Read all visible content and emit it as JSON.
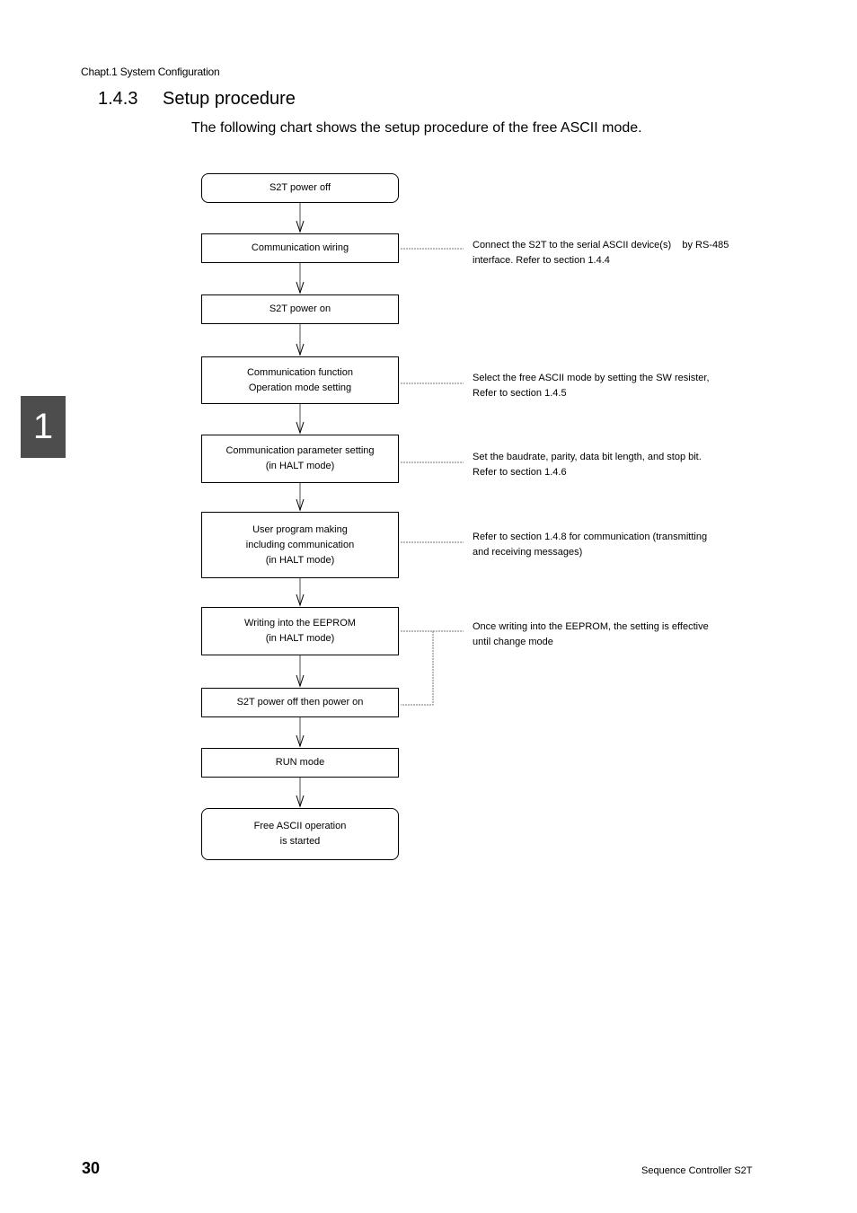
{
  "header": {
    "chapter": "Chapt.1  System Configuration",
    "section_number": "1.4.3",
    "section_title": "Setup procedure",
    "intro": "The following chart shows the setup procedure of the free ASCII mode."
  },
  "chapter_tab": "1",
  "flowchart": {
    "steps": [
      {
        "lines": [
          "S2T power off"
        ]
      },
      {
        "lines": [
          "Communication wiring"
        ]
      },
      {
        "lines": [
          "S2T power on"
        ]
      },
      {
        "lines": [
          "Communication function",
          "Operation mode setting"
        ]
      },
      {
        "lines": [
          "Communication parameter setting",
          "(in HALT mode)"
        ]
      },
      {
        "lines": [
          "User program making",
          "including communication",
          "(in HALT mode)"
        ]
      },
      {
        "lines": [
          "Writing into the EEPROM",
          "(in HALT mode)"
        ]
      },
      {
        "lines": [
          "S2T power off then power on"
        ]
      },
      {
        "lines": [
          "RUN mode"
        ]
      },
      {
        "lines": [
          "Free ASCII operation",
          "is started"
        ]
      }
    ],
    "notes": [
      {
        "lines": [
          "Connect the S2T to the serial ASCII device(s)    by RS-485",
          "interface. Refer to section 1.4.4"
        ]
      },
      {
        "lines": [
          "Select the free ASCII mode by setting the SW resister,",
          "Refer to section 1.4.5"
        ]
      },
      {
        "lines": [
          "Set the baudrate, parity, data bit length, and stop bit.",
          "Refer to section 1.4.6"
        ]
      },
      {
        "lines": [
          "Refer to section 1.4.8 for communication (transmitting",
          "and receiving messages)"
        ]
      },
      {
        "lines": [
          "Once writing into the EEPROM, the setting is effective",
          "until change mode"
        ]
      }
    ]
  },
  "footer": {
    "page_number": "30",
    "document_title": "Sequence Controller S2T"
  }
}
